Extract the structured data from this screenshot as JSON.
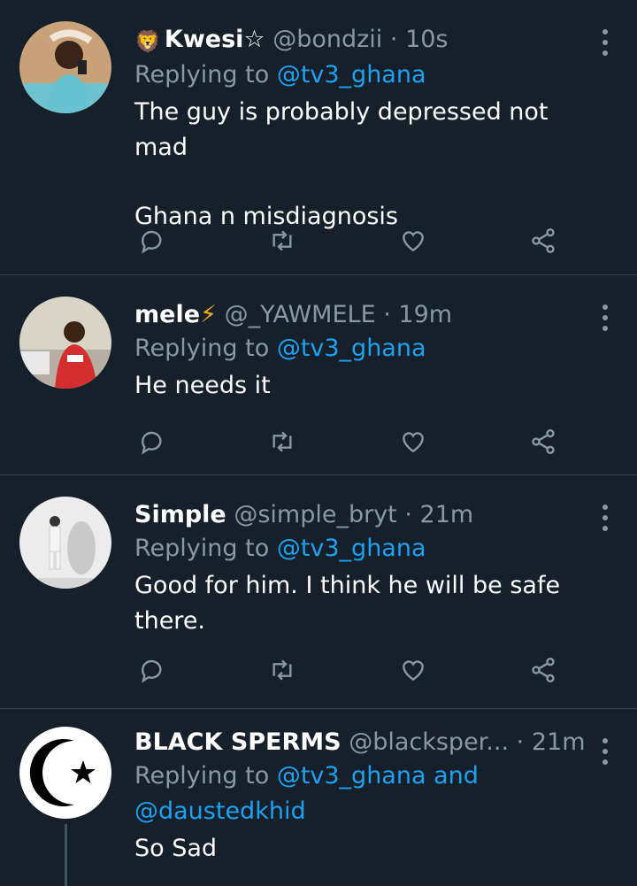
{
  "tweets": [
    {
      "name": "Kwesi☆",
      "emoji": "🦁",
      "handle": "@bondzii",
      "time": "10s",
      "replying_prefix": "Replying to",
      "replying_to": "@tv3_ghana",
      "text_lines": [
        "The guy is probably depressed not mad",
        "Ghana n misdiagnosis"
      ]
    },
    {
      "name": "mele",
      "emoji": "⚡",
      "handle": "@_YAWMELE",
      "time": "19m",
      "replying_prefix": "Replying to",
      "replying_to": "@tv3_ghana",
      "text_lines": [
        "He needs it"
      ]
    },
    {
      "name": "Simple",
      "handle": "@simple_bryt",
      "time": "21m",
      "replying_prefix": "Replying to",
      "replying_to": "@tv3_ghana",
      "text_lines": [
        "Good for him. I think he will be safe there."
      ]
    },
    {
      "name": "BLACK SPERMS",
      "handle": "@blacksper...",
      "time": "21m",
      "replying_prefix": "Replying to",
      "replying_to": "@tv3_ghana and",
      "replying_to_2": "@daustedkhid",
      "text_lines": [
        "So Sad"
      ]
    }
  ],
  "separator": "·",
  "colors": {
    "background": "#15202b",
    "divider": "#38444d",
    "secondary_text": "#8899a6",
    "link": "#1da1f2"
  },
  "icons": [
    "reply-icon",
    "retweet-icon",
    "like-icon",
    "share-icon",
    "more-options-icon"
  ]
}
